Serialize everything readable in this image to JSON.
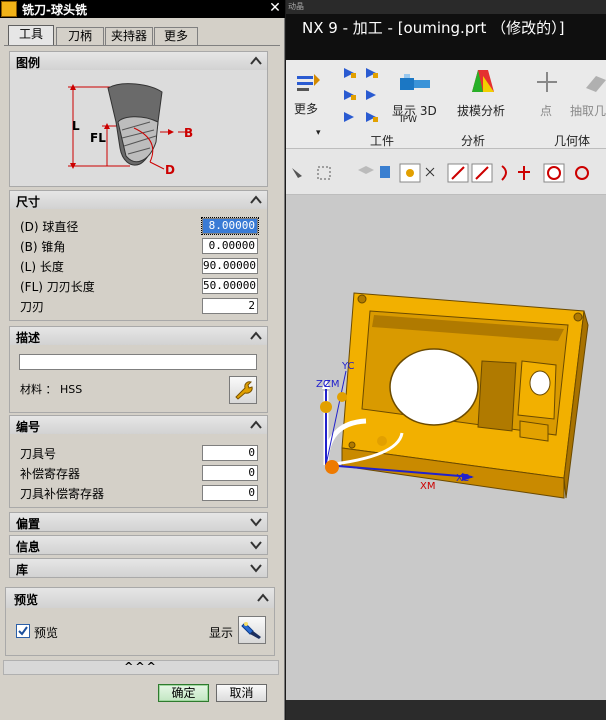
{
  "dialog": {
    "title": "铣刀-球头铣",
    "close_glyph": "✕",
    "tabs": [
      "工具",
      "刀柄",
      "夹持器",
      "更多"
    ],
    "sections": {
      "legend": "图例",
      "dimensions": "尺寸",
      "description": "描述",
      "numbering": "编号",
      "offset": "偏置",
      "info": "信息",
      "library": "库",
      "preview": "预览"
    },
    "figure_labels": {
      "L": "L",
      "FL": "FL",
      "B": "B",
      "D": "D"
    },
    "dimensions": [
      {
        "label": "(D) 球直径",
        "value": "8.00000"
      },
      {
        "label": "(B) 锥角",
        "value": "0.00000"
      },
      {
        "label": "(L) 长度",
        "value": "90.00000"
      },
      {
        "label": "(FL) 刀刃长度",
        "value": "50.00000"
      },
      {
        "label": "刀刃",
        "value": "2"
      }
    ],
    "description_value": "",
    "material": "材料 ： HSS",
    "numbering": [
      {
        "label": "刀具号",
        "value": "0"
      },
      {
        "label": "补偿寄存器",
        "value": "0"
      },
      {
        "label": "刀具补偿寄存器",
        "value": "0"
      }
    ],
    "preview_checkbox": "预览",
    "show_label": "显示",
    "more_glyph": "^^^",
    "ok": "确定",
    "cancel": "取消"
  },
  "nx": {
    "top_strip": "动晶",
    "title": "NX 9 - 加工 - [ouming.prt （修改的）]",
    "ribbon": {
      "more": "更多",
      "show3d": "显示 3D",
      "ipw": "IPW",
      "draft": "拔模分析",
      "point": "点",
      "extract": "抽取几",
      "groups": [
        "工件",
        "分析",
        "几何体"
      ]
    },
    "axes": {
      "zc": "ZC",
      "zm": "ZM",
      "yc": "YC",
      "xm": "XM",
      "xc": "XC"
    }
  },
  "colors": {
    "part": "#f2b000",
    "part_dark": "#c98a00",
    "viewport": "#c9c9c9",
    "ok_border": "#2e7a2e"
  }
}
